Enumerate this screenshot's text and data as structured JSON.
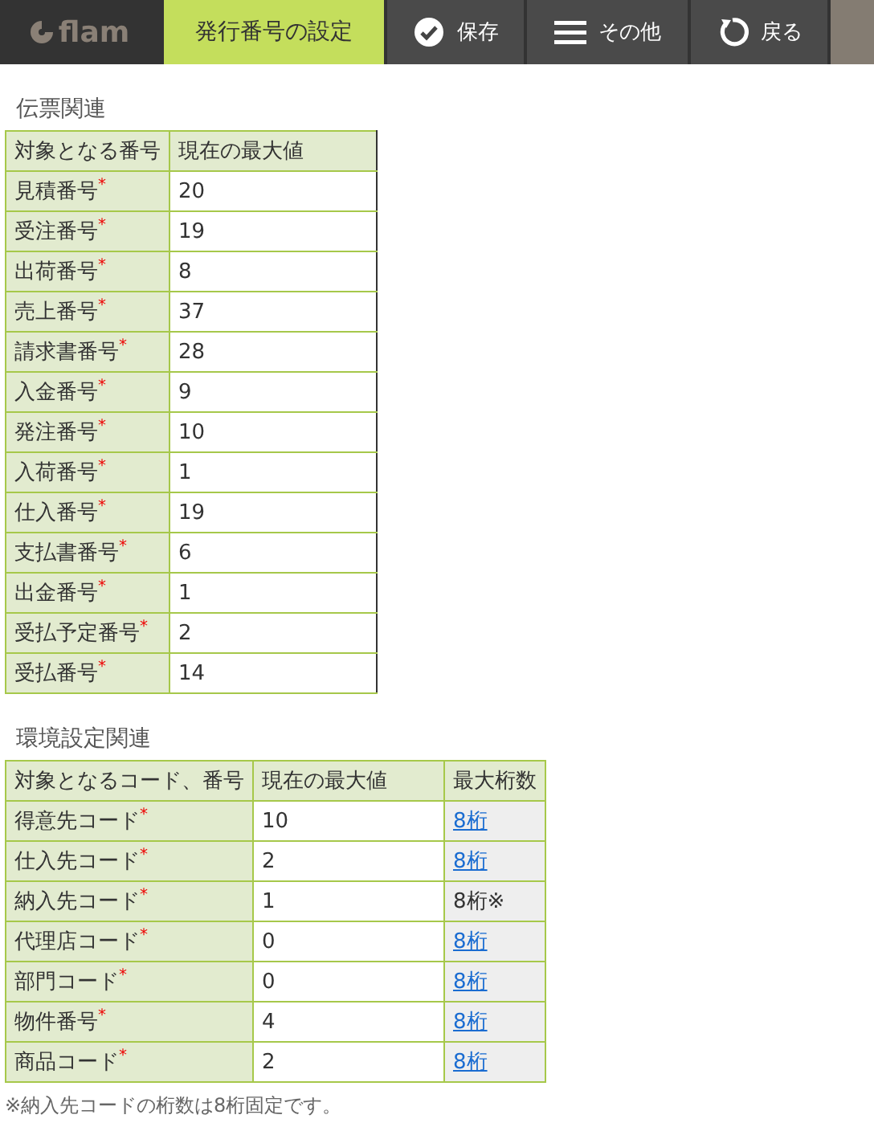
{
  "header": {
    "logo": "flam",
    "title": "発行番号の設定",
    "buttons": [
      {
        "label": "保存",
        "kind": "save"
      },
      {
        "label": "その他",
        "kind": "more"
      },
      {
        "label": "戻る",
        "kind": "back"
      }
    ]
  },
  "sections": [
    {
      "title": "伝票関連",
      "columns": [
        "対象となる番号",
        "現在の最大値"
      ],
      "rows": [
        {
          "name": "見積番号",
          "required": true,
          "value": "20"
        },
        {
          "name": "受注番号",
          "required": true,
          "value": "19"
        },
        {
          "name": "出荷番号",
          "required": true,
          "value": "8"
        },
        {
          "name": "売上番号",
          "required": true,
          "value": "37"
        },
        {
          "name": "請求書番号",
          "required": true,
          "value": "28"
        },
        {
          "name": "入金番号",
          "required": true,
          "value": "9"
        },
        {
          "name": "発注番号",
          "required": true,
          "value": "10"
        },
        {
          "name": "入荷番号",
          "required": true,
          "value": "1"
        },
        {
          "name": "仕入番号",
          "required": true,
          "value": "19"
        },
        {
          "name": "支払書番号",
          "required": true,
          "value": "6"
        },
        {
          "name": "出金番号",
          "required": true,
          "value": "1"
        },
        {
          "name": "受払予定番号",
          "required": true,
          "value": "2"
        },
        {
          "name": "受払番号",
          "required": true,
          "value": "14"
        }
      ]
    },
    {
      "title": "環境設定関連",
      "columns": [
        "対象となるコード、番号",
        "現在の最大値",
        "最大桁数"
      ],
      "rows": [
        {
          "name": "得意先コード",
          "required": true,
          "value": "10",
          "digits": "8桁",
          "digits_link": true
        },
        {
          "name": "仕入先コード",
          "required": true,
          "value": "2",
          "digits": "8桁",
          "digits_link": true
        },
        {
          "name": "納入先コード",
          "required": true,
          "value": "1",
          "digits": "8桁※",
          "digits_link": false
        },
        {
          "name": "代理店コード",
          "required": true,
          "value": "0",
          "digits": "8桁",
          "digits_link": true
        },
        {
          "name": "部門コード",
          "required": true,
          "value": "0",
          "digits": "8桁",
          "digits_link": true
        },
        {
          "name": "物件番号",
          "required": true,
          "value": "4",
          "digits": "8桁",
          "digits_link": true
        },
        {
          "name": "商品コード",
          "required": true,
          "value": "2",
          "digits": "8桁",
          "digits_link": true
        }
      ]
    }
  ],
  "required_mark": "*",
  "note": "※納入先コードの桁数は8桁固定です。"
}
